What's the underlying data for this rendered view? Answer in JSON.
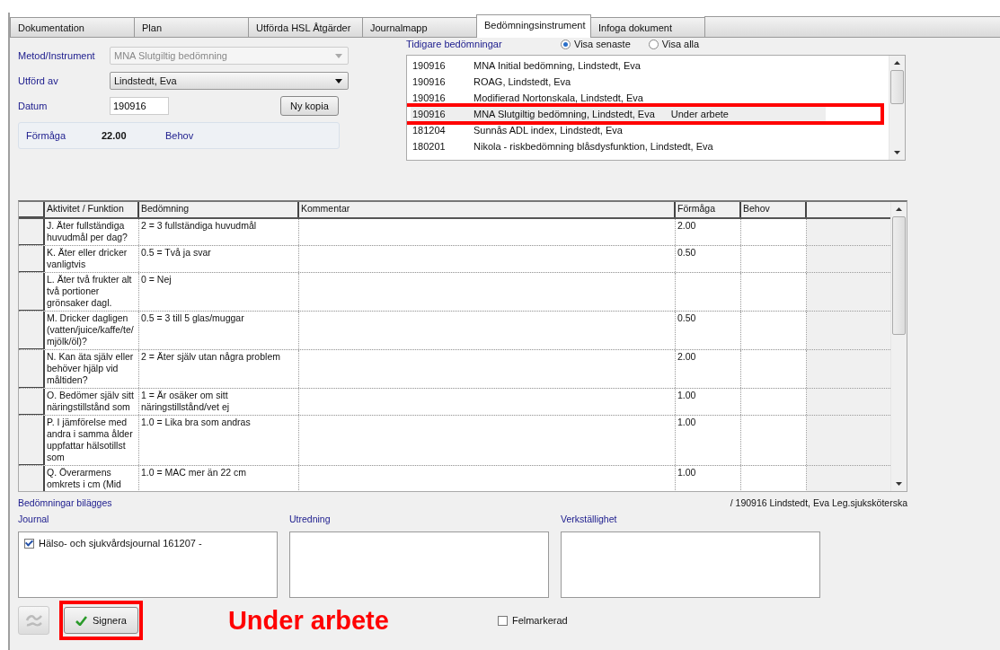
{
  "tabs": [
    {
      "label": "Dokumentation",
      "selected": false
    },
    {
      "label": "Plan",
      "selected": false
    },
    {
      "label": "Utförda HSL Åtgärder",
      "selected": false
    },
    {
      "label": "Journalmapp",
      "selected": false
    },
    {
      "label": "Bedömningsinstrument",
      "selected": true
    },
    {
      "label": "Infoga dokument",
      "selected": false
    }
  ],
  "form": {
    "method_label": "Metod/Instrument",
    "method_value": "MNA Slutgiltig bedömning",
    "method_disabled": true,
    "performer_label": "Utförd av",
    "performer_value": "Lindstedt, Eva",
    "date_label": "Datum",
    "date_value": "190916",
    "copy_button": "Ny kopia",
    "ability_label": "Förmåga",
    "ability_value": "22.00",
    "need_label": "Behov"
  },
  "previous": {
    "title": "Tidigare bedömningar",
    "options": [
      {
        "label": "Visa senaste",
        "selected": true
      },
      {
        "label": "Visa alla",
        "selected": false
      }
    ],
    "items": [
      {
        "date": "190916",
        "text": "MNA Initial bedömning, Lindstedt, Eva",
        "selected": false,
        "highlighted": false
      },
      {
        "date": "190916",
        "text": "ROAG, Lindstedt, Eva",
        "selected": false,
        "highlighted": false
      },
      {
        "date": "190916",
        "text": "Modifierad Nortonskala, Lindstedt, Eva",
        "selected": false,
        "highlighted": false
      },
      {
        "date": "190916",
        "text": "MNA Slutgiltig bedömning, Lindstedt, Eva",
        "status": "Under arbete",
        "selected": true,
        "highlighted": true
      },
      {
        "date": "181204",
        "text": "Sunnås ADL index, Lindstedt, Eva",
        "selected": false,
        "highlighted": false
      },
      {
        "date": "180201",
        "text": "Nikola - riskbedömning blåsdysfunktion, Lindstedt, Eva",
        "selected": false,
        "highlighted": false
      }
    ]
  },
  "table": {
    "columns": [
      "Aktivitet / Funktion",
      "Bedömning",
      "Kommentar",
      "Förmåga",
      "Behov"
    ],
    "rows": [
      {
        "activity": "J. Äter fullständiga huvudmål per dag?",
        "assessment": "2 = 3 fullständiga huvudmål",
        "ability": "2.00"
      },
      {
        "activity": "K. Äter eller dricker vanligtvis",
        "assessment": "0.5 = Två ja svar",
        "ability": "0.50"
      },
      {
        "activity": "L. Äter två frukter alt två portioner grönsaker dagl.",
        "assessment": "0 = Nej"
      },
      {
        "activity": "M. Dricker dagligen (vatten/juice/kaffe/te/mjölk/öl)?",
        "assessment": "0.5 = 3 till 5 glas/muggar",
        "ability": "0.50"
      },
      {
        "activity": "N. Kan äta själv eller behöver hjälp vid måltiden?",
        "assessment": "2 = Äter själv utan några problem",
        "ability": "2.00"
      },
      {
        "activity": "O. Bedömer själv sitt näringstillstånd som",
        "assessment": "1 = Är osäker om sitt näringstillstånd/vet ej",
        "ability": "1.00"
      },
      {
        "activity": "P. I jämförelse med andra i samma ålder uppfattar hälsotillst som",
        "assessment": "1.0 = Lika bra som andras",
        "ability": "1.00"
      },
      {
        "activity": "Q. Överarmens omkrets i cm (Mid",
        "assessment": "1.0 = MAC mer än 22 cm",
        "ability": "1.00"
      }
    ]
  },
  "attachments": {
    "title": "Bedömningar bilägges",
    "signature": "/ 190916 Lindstedt, Eva Leg.sjuksköterska",
    "boxes": [
      {
        "label": "Journal",
        "items": [
          {
            "text": "Hälso- och sjukvårdsjournal 161207 -",
            "checked": true
          }
        ]
      },
      {
        "label": "Utredning"
      },
      {
        "label": "Verkställighet"
      }
    ]
  },
  "footer": {
    "sign_button": "Signera",
    "sign_highlighted": true,
    "status": "Under arbete",
    "error_label": "Felmarkerad",
    "error_checked": false
  }
}
